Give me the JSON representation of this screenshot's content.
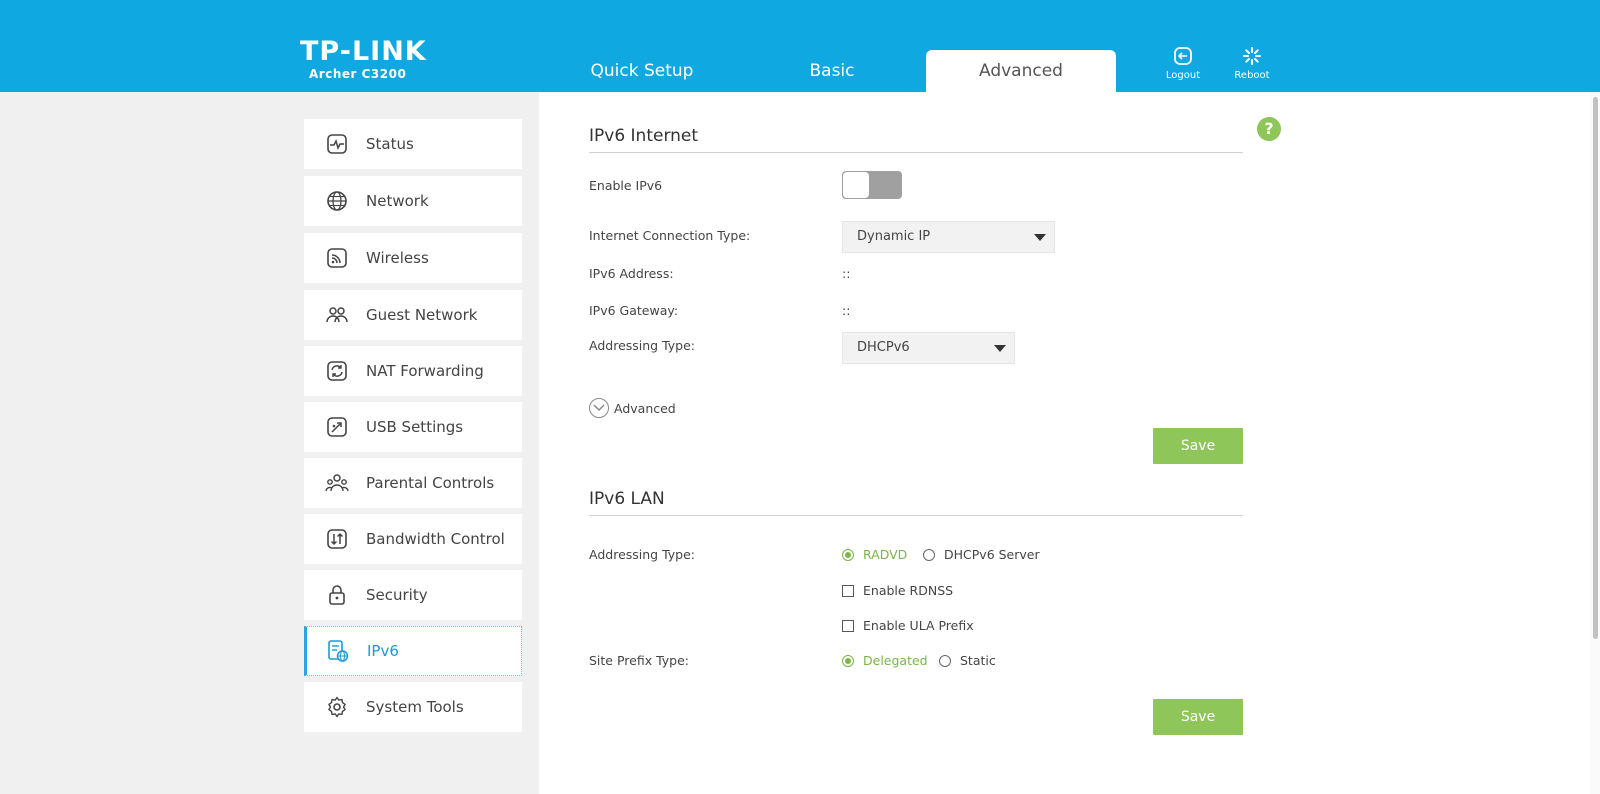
{
  "header": {
    "brand": "TP-LINK",
    "model": "Archer C3200",
    "tabs": [
      {
        "label": "Quick Setup",
        "active": false
      },
      {
        "label": "Basic",
        "active": false
      },
      {
        "label": "Advanced",
        "active": true
      }
    ],
    "logout_label": "Logout",
    "reboot_label": "Reboot"
  },
  "sidebar": {
    "items": [
      {
        "label": "Status",
        "icon": "status-icon",
        "active": false
      },
      {
        "label": "Network",
        "icon": "globe-icon",
        "active": false
      },
      {
        "label": "Wireless",
        "icon": "wireless-icon",
        "active": false
      },
      {
        "label": "Guest Network",
        "icon": "guest-network-icon",
        "active": false
      },
      {
        "label": "NAT Forwarding",
        "icon": "nat-forwarding-icon",
        "active": false
      },
      {
        "label": "USB Settings",
        "icon": "usb-icon",
        "active": false
      },
      {
        "label": "Parental Controls",
        "icon": "parental-controls-icon",
        "active": false
      },
      {
        "label": "Bandwidth Control",
        "icon": "bandwidth-icon",
        "active": false
      },
      {
        "label": "Security",
        "icon": "lock-icon",
        "active": false
      },
      {
        "label": "IPv6",
        "icon": "ipv6-icon",
        "active": true
      },
      {
        "label": "System Tools",
        "icon": "gear-icon",
        "active": false
      }
    ]
  },
  "help": {
    "label": "?"
  },
  "ipv6_internet": {
    "title": "IPv6 Internet",
    "enable_label": "Enable IPv6",
    "enable_value": false,
    "connection_type_label": "Internet Connection Type:",
    "connection_type_value": "Dynamic IP",
    "address_label": "IPv6 Address:",
    "address_value": "::",
    "gateway_label": "IPv6 Gateway:",
    "gateway_value": "::",
    "addressing_type_label": "Addressing Type:",
    "addressing_type_value": "DHCPv6",
    "advanced_label": "Advanced",
    "save_label": "Save"
  },
  "ipv6_lan": {
    "title": "IPv6 LAN",
    "addressing_type_label": "Addressing Type:",
    "addressing_options": [
      {
        "label": "RADVD",
        "selected": true
      },
      {
        "label": "DHCPv6 Server",
        "selected": false
      }
    ],
    "rdnss_label": "Enable RDNSS",
    "rdnss_checked": false,
    "ula_label": "Enable ULA Prefix",
    "ula_checked": false,
    "site_prefix_label": "Site Prefix Type:",
    "site_prefix_options": [
      {
        "label": "Delegated",
        "selected": true
      },
      {
        "label": "Static",
        "selected": false
      }
    ],
    "save_label": "Save"
  },
  "colors": {
    "header_blue": "#0fa8e0",
    "accent_green": "#8fc65a",
    "active_blue": "#2aa6dc"
  }
}
